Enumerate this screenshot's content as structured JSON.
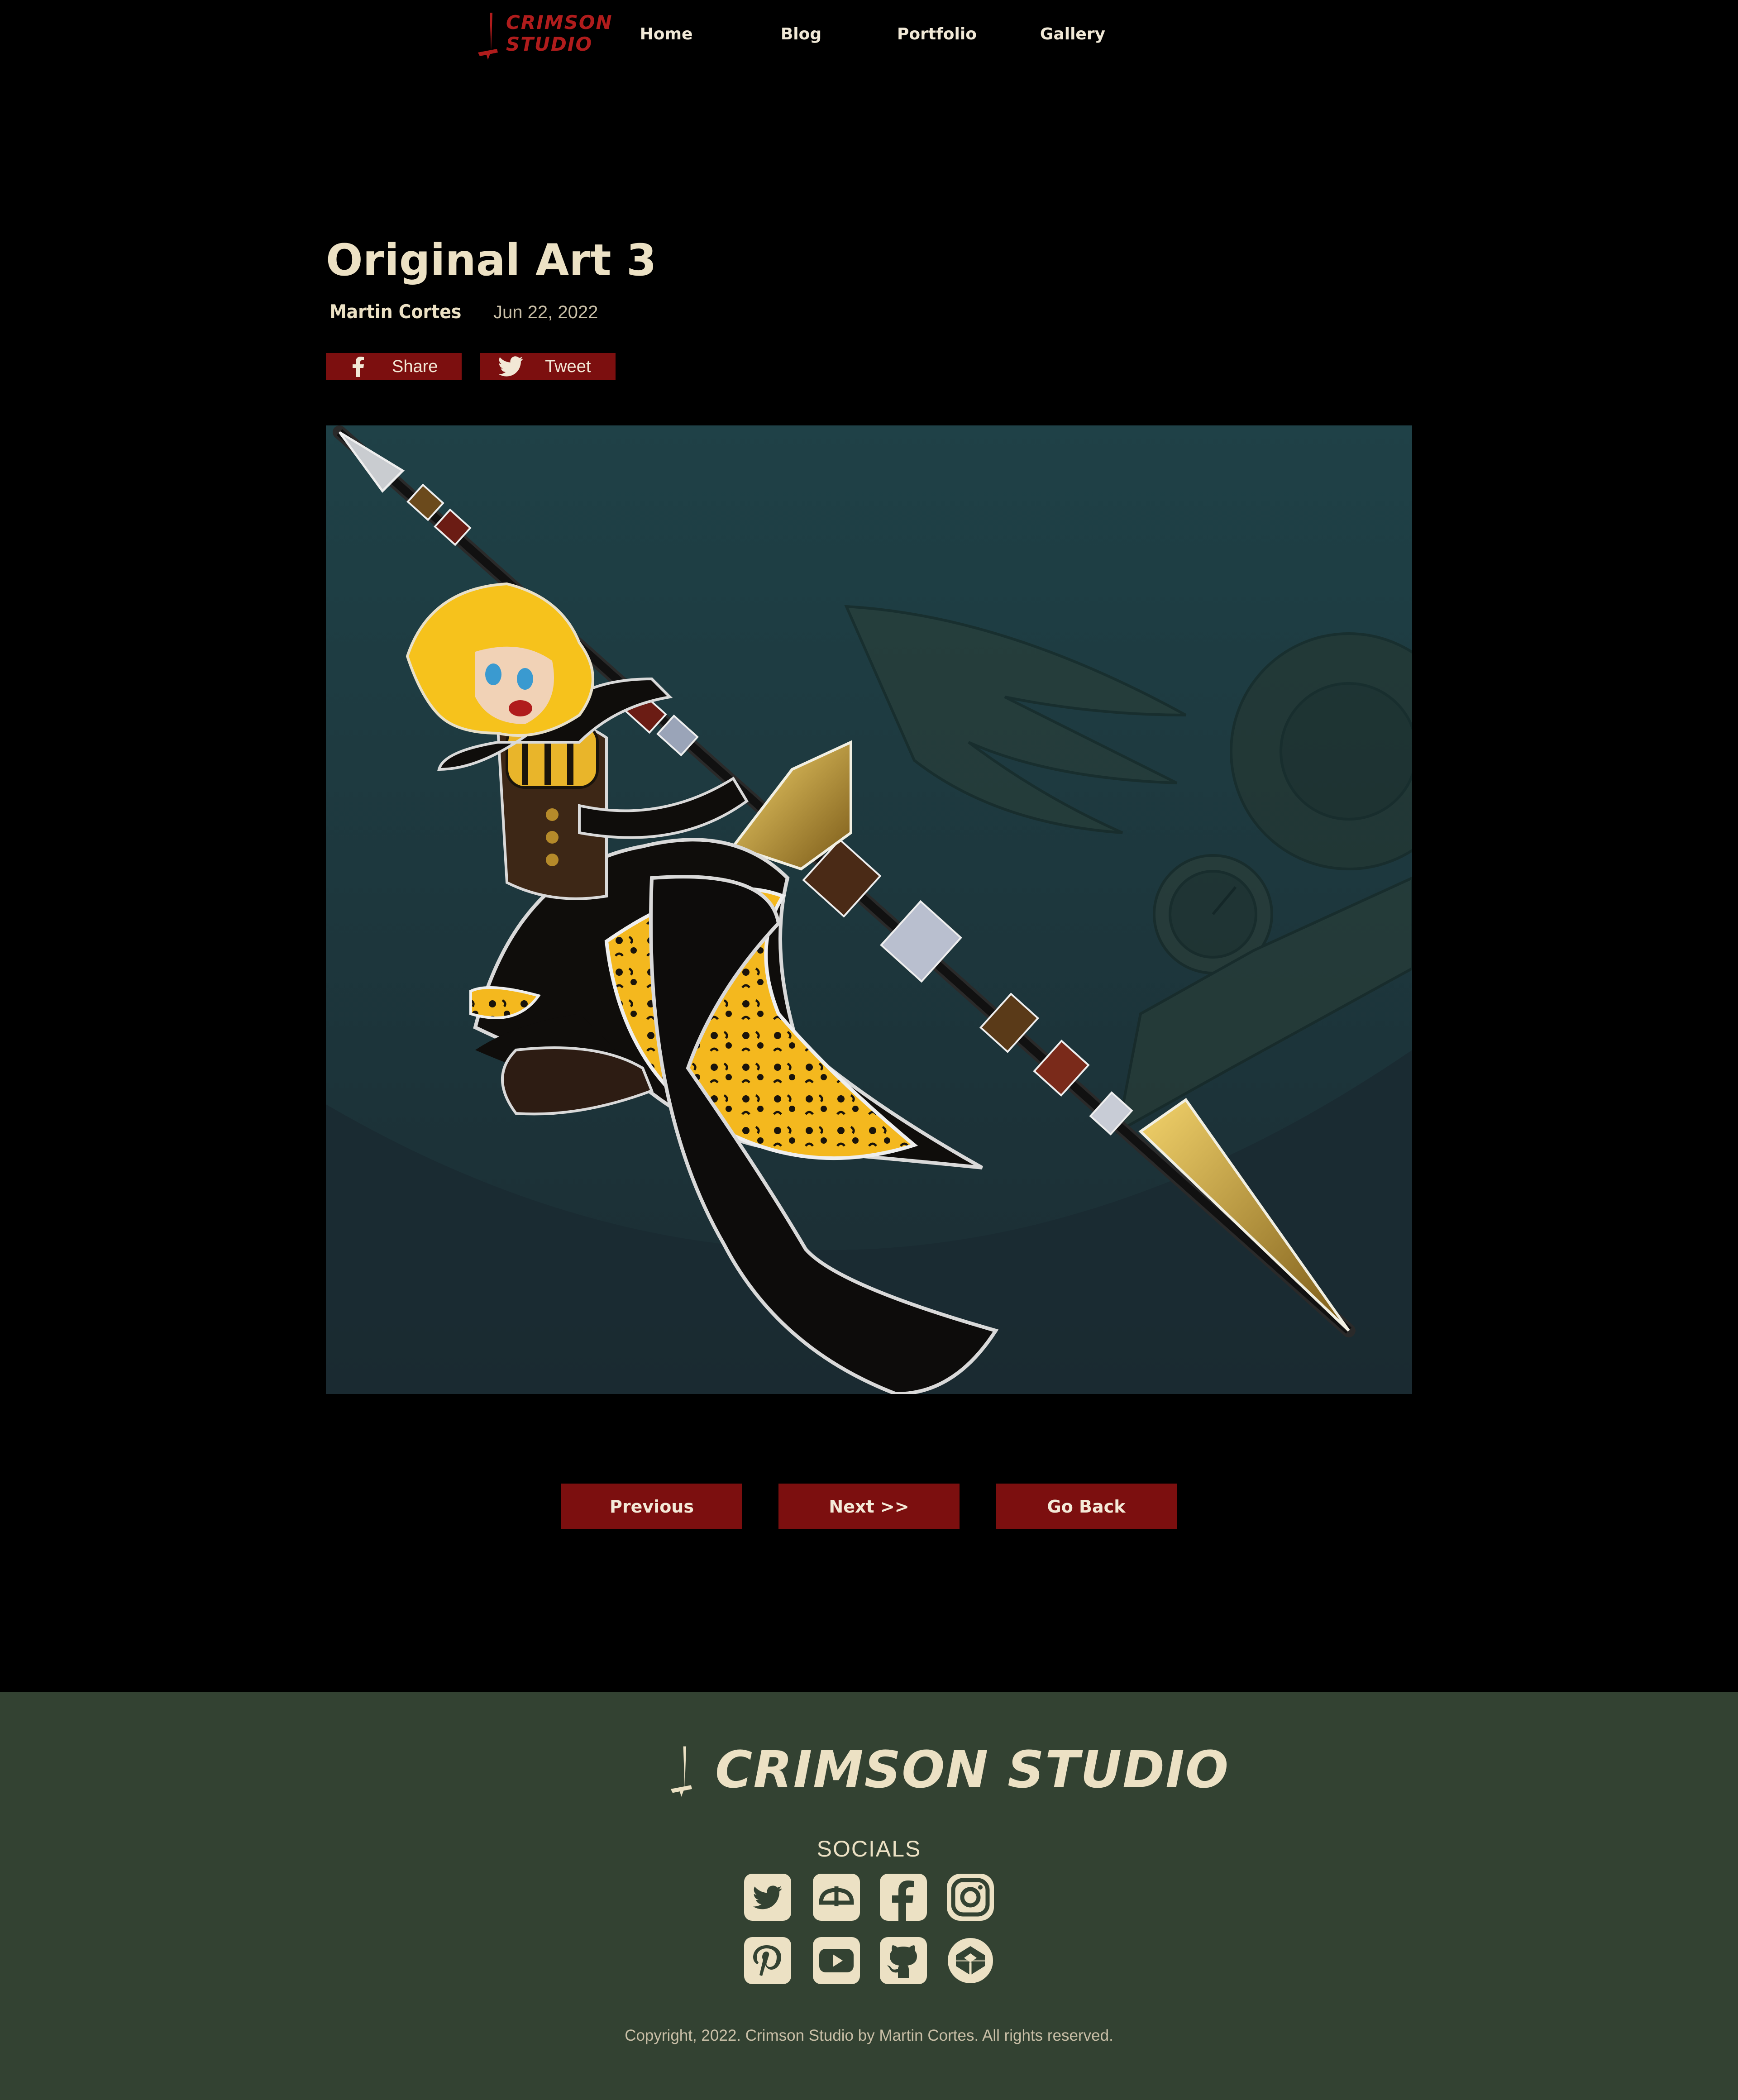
{
  "nav": {
    "logo_line1": "CRIMSON",
    "logo_line2": "STUDIO",
    "links": [
      "Home",
      "Blog",
      "Portfolio",
      "Gallery"
    ]
  },
  "article": {
    "title": "Original Art 3",
    "author": "Martin Cortes",
    "date": "Jun 22, 2022",
    "share_label": "Share",
    "tweet_label": "Tweet"
  },
  "pager": {
    "previous": "Previous",
    "next": "Next >>",
    "back": "Go Back"
  },
  "footer": {
    "brand": "CRIMSON STUDIO",
    "socials_title": "SOCIALS",
    "socials": [
      "twitter-icon",
      "deviantart-icon",
      "facebook-icon",
      "instagram-icon",
      "pinterest-icon",
      "youtube-icon",
      "github-icon",
      "codepen-icon"
    ],
    "copyright": "Copyright, 2022. Crimson Studio by Martin Cortes. All rights reserved."
  },
  "colors": {
    "accent": "#7c0f0f",
    "logo_red": "#b01c1c",
    "cream": "#ece1c4",
    "footer_bg": "#334232",
    "page_bg": "#000000"
  }
}
